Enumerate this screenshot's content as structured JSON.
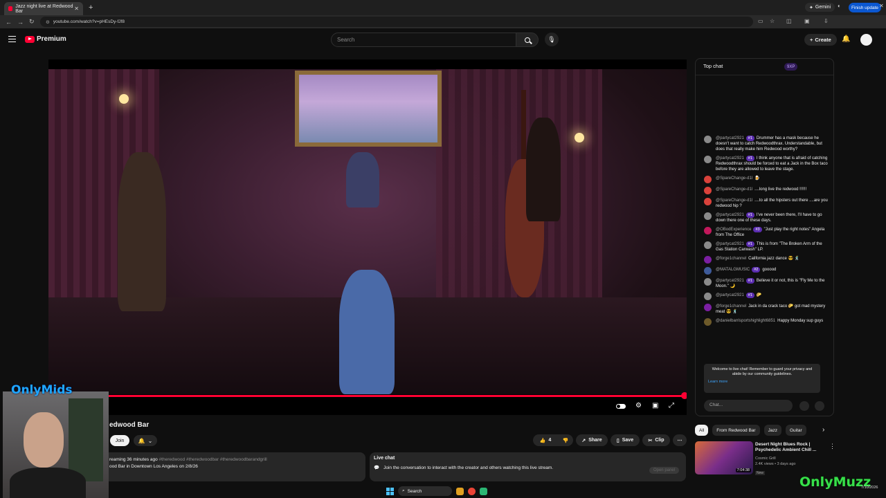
{
  "browser": {
    "tab_title": "Jazz night live at Redwood Bar",
    "new_tab_icon": "+",
    "url": "youtube.com/watch?v=pHEsDy-fJf8",
    "gemini_label": "Gemini",
    "finish_update_label": "Finish update"
  },
  "header": {
    "brand": "Premium",
    "search_placeholder": "Search",
    "create_label": "Create"
  },
  "video": {
    "title_visible": "edwood Bar",
    "join_label": "Join",
    "like_count": "4",
    "share_label": "Share",
    "save_label": "Save",
    "clip_label": "Clip",
    "progress": 1.0
  },
  "description": {
    "line1_prefix": "reaming 36 minutes ago",
    "tags": "#theredwood #theredwoodbar #theredwoodbarandgrill",
    "line2": "ood Bar in Downtown Los Angeles on 2/8/26"
  },
  "live_chat_box": {
    "heading": "Live chat",
    "text": "Join the conversation to interact with the creator and others watching this live stream.",
    "open_panel_label": "Open panel"
  },
  "chat": {
    "header": "Top chat",
    "xp_label": "9XP",
    "messages": [
      {
        "user": "@partycat2921",
        "badge": "#1",
        "text": "Drummer has a mask because he doesn't want to catch Redwoodthrax. Understandable, but does that really make him Redwood worthy?",
        "color": "#8a8a8a"
      },
      {
        "user": "@partycat2921",
        "badge": "#1",
        "text": "I think anyone that is afraid of catching Redwoodthrax should be forced to eat a Jack in the Box taco before they are allowed to leave the stage.",
        "color": "#8a8a8a"
      },
      {
        "user": "@SpareChange-d1l",
        "badge": "",
        "text": "🍺",
        "color": "#d9423b"
      },
      {
        "user": "@SpareChange-d1l",
        "badge": "",
        "text": "....long live the redwood !!!!!!",
        "color": "#d9423b"
      },
      {
        "user": "@SpareChange-d1l",
        "badge": "",
        "text": "....to all the hipsters out there ....are you redwood hip ?",
        "color": "#d9423b"
      },
      {
        "user": "@partycat2921",
        "badge": "#1",
        "text": "I've never been there, I'll have to go down there one of these days.",
        "color": "#8a8a8a"
      },
      {
        "user": "@OBodExperience",
        "badge": "#3",
        "text": "\"Just play the right notes\" Angela from The Office",
        "color": "#c2185b"
      },
      {
        "user": "@partycat2921",
        "badge": "#1",
        "text": "This is from \"The Broken Arm of the Gas Station Carwash\" LP.",
        "color": "#8a8a8a"
      },
      {
        "user": "@forge1channel",
        "badge": "",
        "text": "California jazz dance 😎 🕺",
        "color": "#7b1fa2"
      },
      {
        "user": "@MATALGMUSIC",
        "badge": "#2",
        "text": "gooood",
        "color": "#3d5a99"
      },
      {
        "user": "@partycat2921",
        "badge": "#1",
        "text": "Believe it or not, this is \"Fly Me to the Moon.\" 🌙",
        "color": "#8a8a8a"
      },
      {
        "user": "@partycat2921",
        "badge": "#1",
        "text": "🌮",
        "color": "#8a8a8a"
      },
      {
        "user": "@forge1channel",
        "badge": "",
        "text": "Jack in da crack taco 🌮 got mad mystery meat 😎 🕺",
        "color": "#7b1fa2"
      },
      {
        "user": "@danielbarrisportshighlight6851",
        "badge": "",
        "text": "Happy Monday sup guys",
        "color": "#6d5a2a"
      }
    ],
    "welcome_text": "Welcome to live chat! Remember to guard your privacy and abide by our community guidelines.",
    "learn_more": "Learn more",
    "input_placeholder": "Chat..."
  },
  "chips": [
    "All",
    "From Redwood Bar",
    "Jazz",
    "Guitar"
  ],
  "recommended": {
    "title": "Desert Night Blues Rock | Psychedelic Ambient Chill ...",
    "channel": "Cosmic Grill",
    "meta": "2.4K views • 3 days ago",
    "badge": "New",
    "duration": "7:04:38"
  },
  "overlays": {
    "webcam_brand": "OnlyMids",
    "corner_brand": "OnlyMuzz"
  },
  "taskbar": {
    "search_label": "Search",
    "date": "7/10/2026"
  },
  "colors": {
    "accent": "#ff0033",
    "background": "#0f0f0f",
    "surface": "#272727",
    "link": "#3ea6ff"
  }
}
